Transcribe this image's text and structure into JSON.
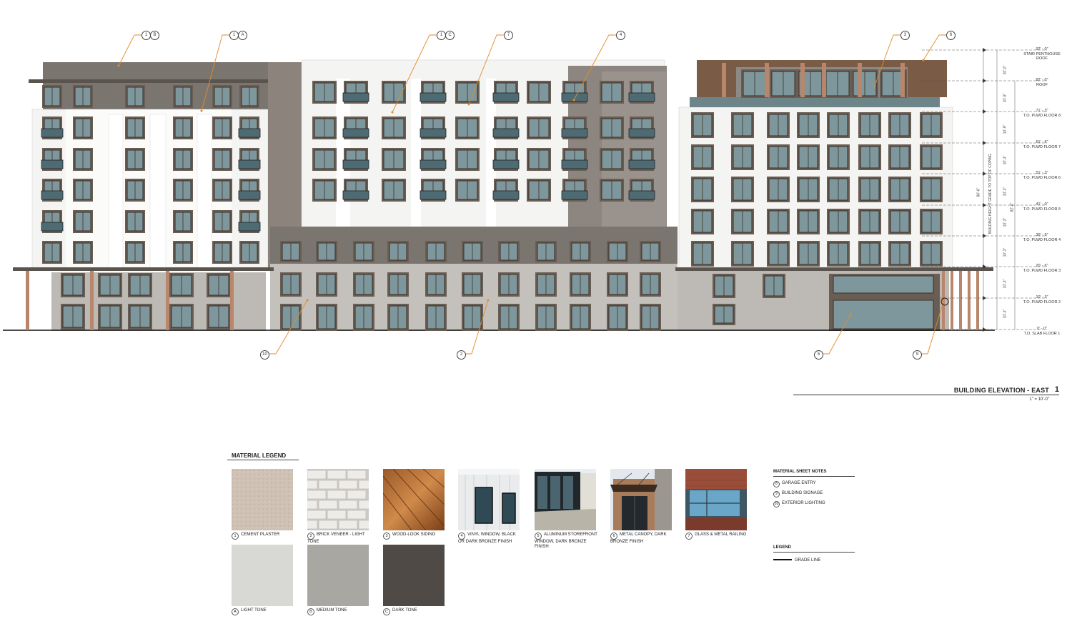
{
  "tags": {
    "t1b": "1",
    "t1b_sub": "B",
    "t1a": "1",
    "t1a_sub": "A",
    "t1c": "1",
    "t1c_sub": "C",
    "t7": "7",
    "t4": "4",
    "t3": "3",
    "t6": "6",
    "t10": "10",
    "t2": "2",
    "t5": "5",
    "t9": "9"
  },
  "levels": [
    {
      "elev": "92' - 0\"",
      "name": "STAIR PENTHOUSE ROOF"
    },
    {
      "elev": "82' - 0\"",
      "name": "ROOF"
    },
    {
      "elev": "71' - 3\"",
      "name": "T.O. PLWD FLOOR 8"
    },
    {
      "elev": "61' - 6\"",
      "name": "T.O. PLWD FLOOR 7"
    },
    {
      "elev": "51' - 3\"",
      "name": "T.O. PLWD FLOOR 6"
    },
    {
      "elev": "41' - 0\"",
      "name": "T.O. PLWD FLOOR 5"
    },
    {
      "elev": "30' - 9\"",
      "name": "T.O. PLWD FLOOR 4"
    },
    {
      "elev": "20' - 6\"",
      "name": "T.O. PLWD FLOOR 3"
    },
    {
      "elev": "10' - 3\"",
      "name": "T.O. PLWD FLOOR 2"
    },
    {
      "elev": "0' - 0\"",
      "name": "T.O. SLAB FLOOR 1"
    }
  ],
  "dims": {
    "d1": "10'-0\"",
    "d2": "10'-9\"",
    "d3": "10'-9\"",
    "d4": "10'-3\"",
    "d5": "10'-3\"",
    "d6": "10'-3\"",
    "d7": "10'-3\"",
    "d8": "10'-3\"",
    "d9": "10'-3\"",
    "height_note": "BUILDING HEIGHT GRADE TO TOP OF COPING",
    "height_val": "86'-6\"",
    "overall": "82'-0\""
  },
  "title": {
    "text": "BUILDING ELEVATION - EAST",
    "number": "1",
    "scale": "1\" = 10'-0\""
  },
  "legend": {
    "title": "MATERIAL LEGEND",
    "items": [
      {
        "num": "1",
        "label": "CEMENT PLASTER"
      },
      {
        "num": "2",
        "label": "BRICK VENEER - LIGHT TONE"
      },
      {
        "num": "3",
        "label": "WOOD-LOOK SIDING"
      },
      {
        "num": "4",
        "label": "VINYL WINDOW, BLACK OR DARK BRONZE FINISH"
      },
      {
        "num": "5",
        "label": "ALUMINUM STOREFRONT WINDOW, DARK BRONZE FINISH"
      },
      {
        "num": "6",
        "label": "METAL CANOPY, DARK BRONZE FINISH"
      },
      {
        "num": "7",
        "label": "GLASS & METAL RAILING"
      },
      {
        "num": "A",
        "label": "LIGHT TONE"
      },
      {
        "num": "B",
        "label": "MEDIUM TONE"
      },
      {
        "num": "C",
        "label": "DARK TONE"
      }
    ]
  },
  "notes": {
    "title": "MATERIAL SHEET NOTES",
    "items": [
      {
        "num": "8",
        "label": "GARAGE ENTRY"
      },
      {
        "num": "9",
        "label": "BUILDING SIGNAGE"
      },
      {
        "num": "10",
        "label": "EXTERIOR LIGHTING"
      }
    ]
  },
  "legend2": {
    "title": "LEGEND",
    "grade": "GRADE LINE"
  },
  "colors": {
    "light": "#f4f4f2",
    "medium": "#7b7570",
    "dark": "#6a5e54",
    "brick": "#b9b4ae",
    "wood": "#7a5b46",
    "glass": "#7e979c",
    "frame": "#3a2f29",
    "leader": "#e58a2a",
    "swatch_a": "#d8d8d5",
    "swatch_b": "#a9a7a2",
    "swatch_c": "#4f4a46"
  }
}
